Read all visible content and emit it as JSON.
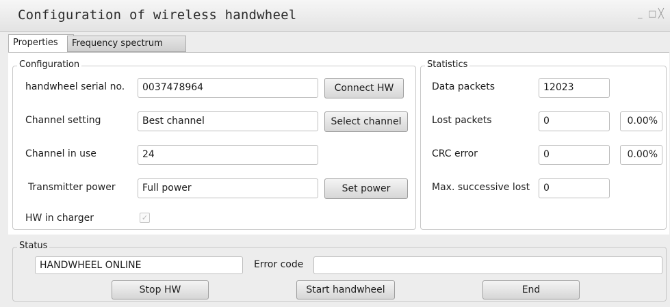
{
  "window": {
    "title": "Configuration of wireless handwheel",
    "controls": {
      "minimize": "_",
      "maximize": "□",
      "close": "╳"
    }
  },
  "tabs": [
    {
      "label": "Properties",
      "active": true
    },
    {
      "label": "Frequency spectrum",
      "active": false
    }
  ],
  "configuration": {
    "legend": "Configuration",
    "serial_label": "handwheel serial no.",
    "serial_value": "0037478964",
    "connect_button": "Connect HW",
    "channel_setting_label": "Channel setting",
    "channel_setting_value": "Best channel",
    "select_channel_button": "Select channel",
    "channel_in_use_label": "Channel in use",
    "channel_in_use_value": "24",
    "transmitter_power_label": "Transmitter power",
    "transmitter_power_value": "Full power",
    "set_power_button": "Set power",
    "hw_in_charger_label": "HW in charger",
    "hw_in_charger_checked": true
  },
  "statistics": {
    "legend": "Statistics",
    "data_packets_label": "Data packets",
    "data_packets_value": "12023",
    "lost_packets_label": "Lost packets",
    "lost_packets_value": "0",
    "lost_packets_pct": "0.00%",
    "crc_error_label": "CRC error",
    "crc_error_value": "0",
    "crc_error_pct": "0.00%",
    "max_lost_label": "Max. successive lost",
    "max_lost_value": "0"
  },
  "status": {
    "legend": "Status",
    "status_value": "HANDWHEEL ONLINE",
    "error_code_label": "Error code",
    "error_code_value": "",
    "stop_button": "Stop HW",
    "start_button": "Start handwheel",
    "end_button": "End"
  }
}
